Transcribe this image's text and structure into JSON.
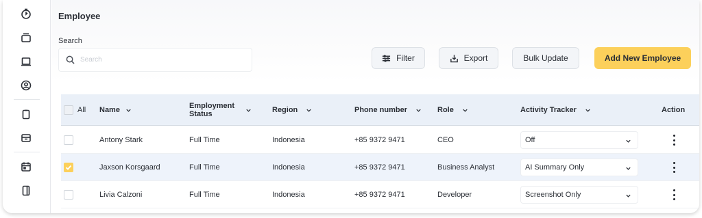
{
  "page": {
    "title": "Employee"
  },
  "search": {
    "label": "Search",
    "placeholder": "Search"
  },
  "toolbar": {
    "filter_label": "Filter",
    "export_label": "Export",
    "bulk_update_label": "Bulk Update",
    "add_employee_label": "Add New Employee"
  },
  "sidebar": {
    "icons": [
      "timer-icon",
      "inbox-icon",
      "laptop-icon",
      "user-circle-icon",
      "clipboard-icon",
      "archive-icon",
      "calendar-icon",
      "tablet-icon"
    ]
  },
  "table": {
    "select_all_label": "All",
    "columns": {
      "name": "Name",
      "employment_status": "Employment Status",
      "region": "Region",
      "phone": "Phone number",
      "role": "Role",
      "activity_tracker": "Activity Tracker",
      "action": "Action"
    },
    "rows": [
      {
        "checked": false,
        "name": "Antony Stark",
        "employment_status": "Full Time",
        "region": "Indonesia",
        "phone": "+85 9372 9471",
        "role": "CEO",
        "activity_tracker": "Off"
      },
      {
        "checked": true,
        "name": "Jaxson Korsgaard",
        "employment_status": "Full Time",
        "region": "Indonesia",
        "phone": "+85 9372 9471",
        "role": "Business Analyst",
        "activity_tracker": "AI Summary Only"
      },
      {
        "checked": false,
        "name": "Livia Calzoni",
        "employment_status": "Full Time",
        "region": "Indonesia",
        "phone": "+85 9372 9471",
        "role": "Developer",
        "activity_tracker": "Screenshot Only"
      }
    ]
  },
  "colors": {
    "accent": "#fcd05b",
    "header_bg": "#eaf0f8",
    "row_alt_bg": "#eef3fb"
  }
}
